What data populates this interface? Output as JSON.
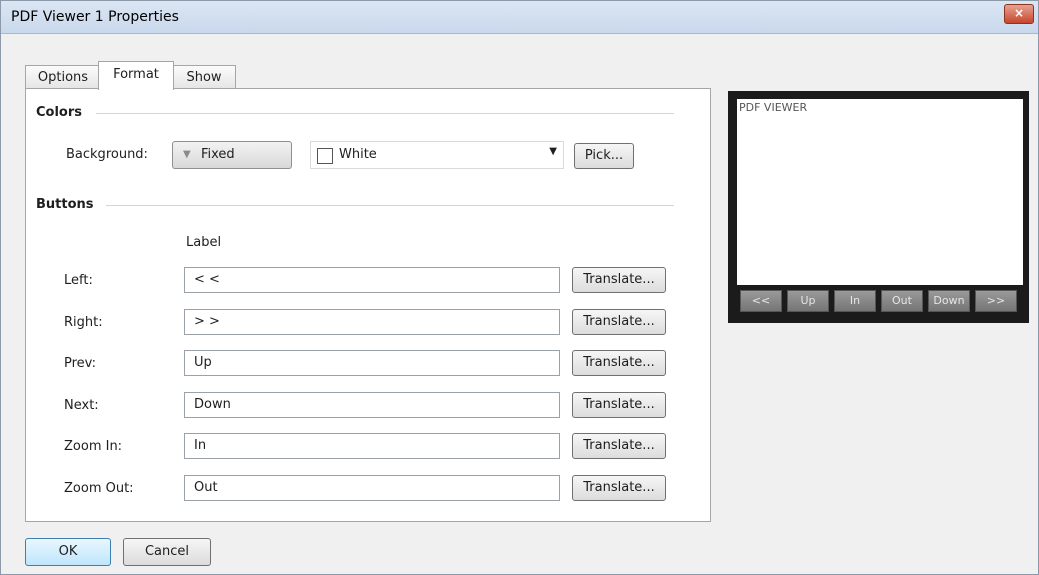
{
  "window": {
    "title": "PDF Viewer 1 Properties",
    "close_glyph": "×"
  },
  "tabs": [
    {
      "label": "Options",
      "active": false
    },
    {
      "label": "Format",
      "active": true
    },
    {
      "label": "Show",
      "active": false
    }
  ],
  "colors": {
    "group_label": "Colors",
    "background_label": "Background:",
    "mode_value": "Fixed",
    "mode_arrow_icon": "triangle-down",
    "color_value": "White",
    "pick_label": "Pick..."
  },
  "buttons_group": {
    "group_label": "Buttons",
    "column_label": "Label",
    "translate_label": "Translate...",
    "rows": [
      {
        "label": "Left:",
        "value": "< <"
      },
      {
        "label": "Right:",
        "value": "> >"
      },
      {
        "label": "Prev:",
        "value": "Up"
      },
      {
        "label": "Next:",
        "value": "Down"
      },
      {
        "label": "Zoom In:",
        "value": "In"
      },
      {
        "label": "Zoom Out:",
        "value": "Out"
      }
    ]
  },
  "preview": {
    "caption": "PDF VIEWER",
    "buttons": [
      "<<",
      "Up",
      "In",
      "Out",
      "Down",
      ">>"
    ]
  },
  "footer": {
    "ok_label": "OK",
    "cancel_label": "Cancel"
  }
}
